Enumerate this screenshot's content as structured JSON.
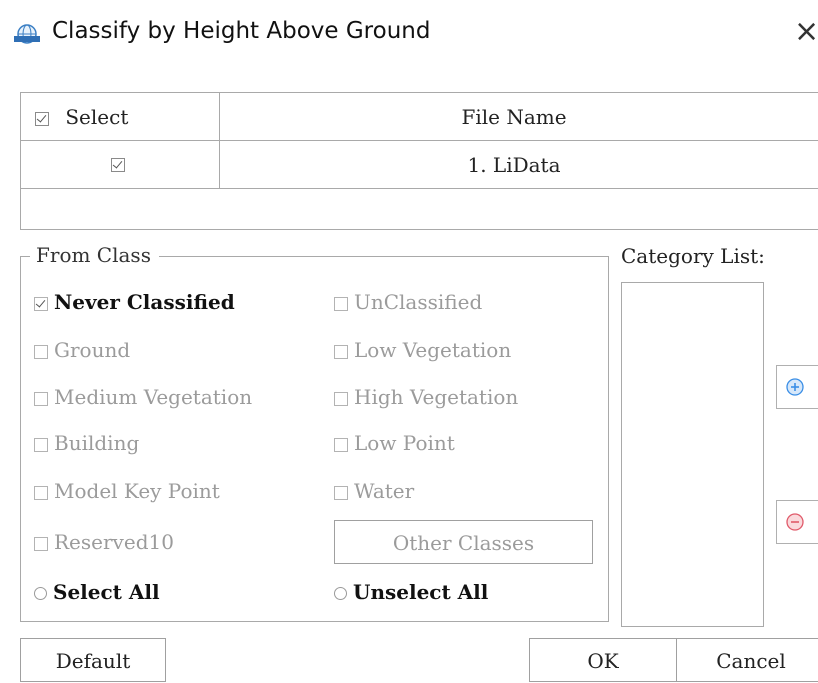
{
  "window": {
    "title": "Classify by Height Above Ground",
    "close_glyph": "×",
    "app_icon": "globe-app-icon"
  },
  "file_table": {
    "columns": [
      "Select",
      "File Name"
    ],
    "header_checked": true,
    "rows": [
      {
        "checked": true,
        "file_name": "1. LiData"
      }
    ]
  },
  "from_class": {
    "legend": "From Class",
    "options": [
      {
        "label": "Never Classified",
        "checked": true,
        "enabled": true
      },
      {
        "label": "UnClassified",
        "checked": false,
        "enabled": false
      },
      {
        "label": "Ground",
        "checked": false,
        "enabled": false
      },
      {
        "label": "Low Vegetation",
        "checked": false,
        "enabled": false
      },
      {
        "label": "Medium Vegetation",
        "checked": false,
        "enabled": false
      },
      {
        "label": "High Vegetation",
        "checked": false,
        "enabled": false
      },
      {
        "label": "Building",
        "checked": false,
        "enabled": false
      },
      {
        "label": "Low Point",
        "checked": false,
        "enabled": false
      },
      {
        "label": "Model Key Point",
        "checked": false,
        "enabled": false
      },
      {
        "label": "Water",
        "checked": false,
        "enabled": false
      },
      {
        "label": "Reserved10",
        "checked": false,
        "enabled": false
      }
    ],
    "other_classes_label": "Other Classes",
    "select_all_label": "Select All",
    "unselect_all_label": "Unselect All"
  },
  "category_list": {
    "label": "Category List:",
    "items": [],
    "add_icon": "plus-circle-icon",
    "remove_icon": "minus-circle-icon"
  },
  "buttons": {
    "default_label": "Default",
    "ok_label": "OK",
    "cancel_label": "Cancel"
  },
  "colors": {
    "add_accent": "#3a8ee6",
    "remove_accent": "#e05a6a",
    "disabled_text": "#9b9b9b"
  }
}
